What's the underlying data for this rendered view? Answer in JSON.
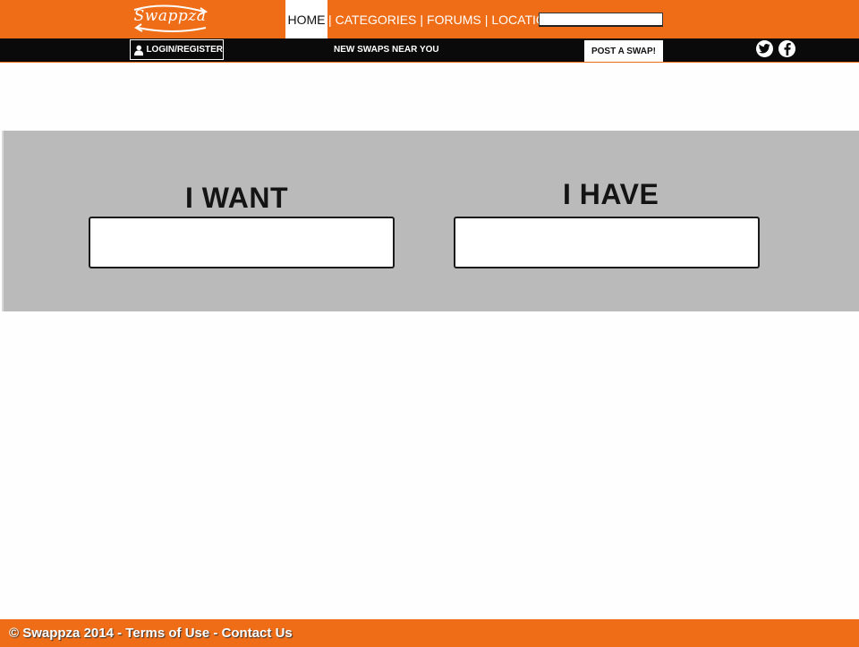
{
  "header": {
    "logo_text": "Swappza",
    "nav": {
      "home": "HOME",
      "separator": "|",
      "categories": "CATEGORIES",
      "forums": "FORUMS",
      "location": "LOCATION"
    },
    "search": {
      "value": "",
      "placeholder": ""
    }
  },
  "subbar": {
    "login_label": "LOGIN/REGISTER",
    "new_swaps_label": "NEW SWAPS NEAR YOU",
    "post_label": "POST A SWAP!",
    "social_icons": [
      "twitter-icon",
      "facebook-icon"
    ]
  },
  "main": {
    "want_label": "I WANT",
    "have_label": "I HAVE",
    "want_value": "",
    "have_value": ""
  },
  "footer": {
    "copyright": "© Swappza 2014",
    "separator": " - ",
    "terms": "Terms of Use",
    "contact": "Contact Us"
  },
  "colors": {
    "brand_orange": "#ef6d17",
    "subbar_black": "#0a0a0a",
    "band_grey": "#bababa"
  }
}
